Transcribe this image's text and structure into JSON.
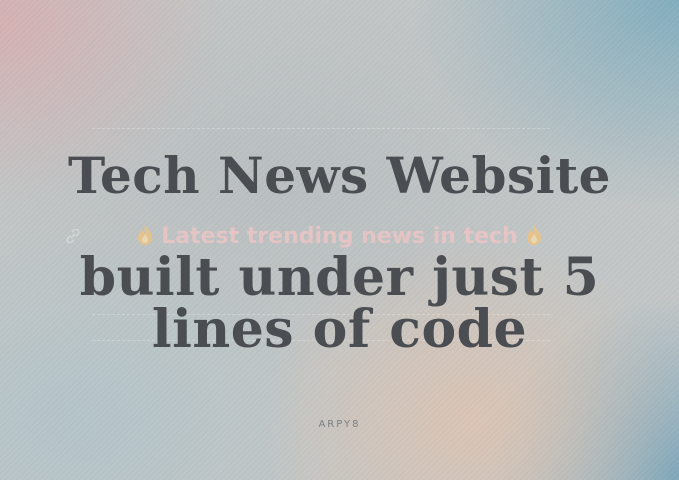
{
  "title_line1": "Tech News Website",
  "overlay_text": "Latest trending news in tech",
  "title_line2": "built under just 5",
  "title_line3": "lines of code",
  "author": "ARPY8",
  "icons": {
    "overlay_left": "fire-icon",
    "overlay_right": "fire-icon",
    "link": "link-icon"
  },
  "colors": {
    "title": "#4a4d52",
    "overlay": "#ecc4c4",
    "author": "#7c7f84"
  }
}
